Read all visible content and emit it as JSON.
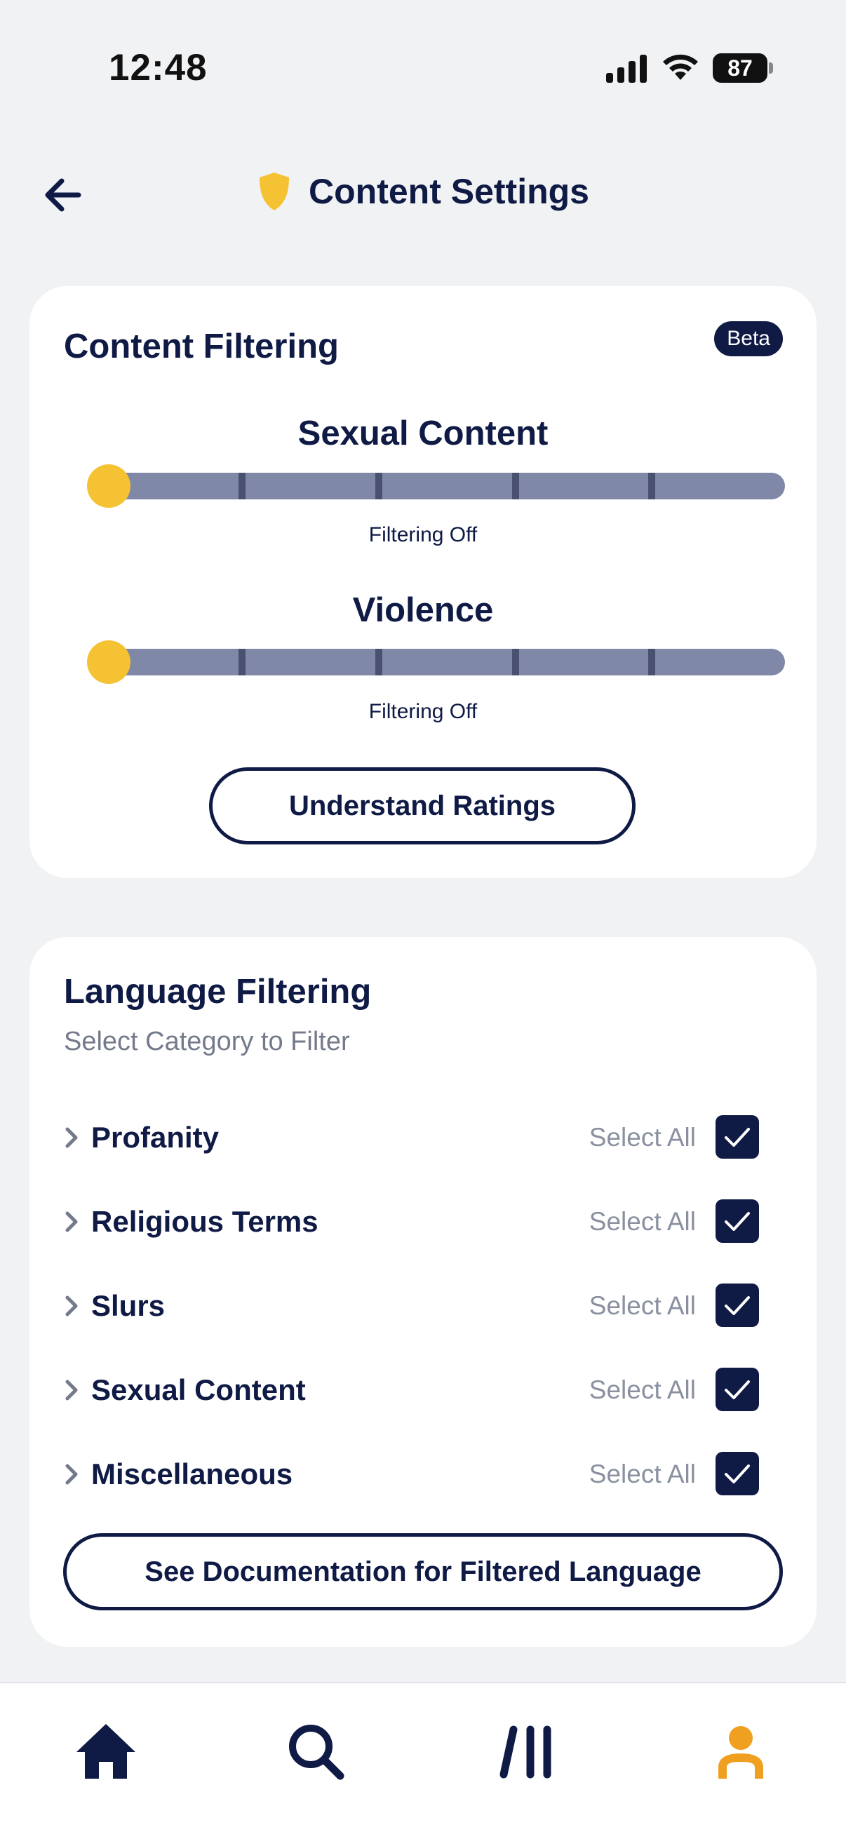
{
  "status_bar": {
    "time": "12:48",
    "battery": "87"
  },
  "header": {
    "title": "Content Settings",
    "back_icon": "arrow-left-icon",
    "title_icon": "shield-icon"
  },
  "content_filtering": {
    "heading": "Content Filtering",
    "badge": "Beta",
    "sliders": [
      {
        "label": "Sexual Content",
        "caption": "Filtering Off",
        "level": 0,
        "steps": 5
      },
      {
        "label": "Violence",
        "caption": "Filtering Off",
        "level": 0,
        "steps": 5
      }
    ],
    "understand_button": "Understand Ratings"
  },
  "language_filtering": {
    "heading": "Language Filtering",
    "subheading": "Select Category to Filter",
    "select_all_label": "Select All",
    "categories": [
      {
        "label": "Profanity",
        "checked": true
      },
      {
        "label": "Religious Terms",
        "checked": true
      },
      {
        "label": "Slurs",
        "checked": true
      },
      {
        "label": "Sexual Content",
        "checked": true
      },
      {
        "label": "Miscellaneous",
        "checked": true
      }
    ],
    "docs_button": "See Documentation for Filtered Language"
  },
  "bottom_nav": {
    "items": [
      "home-icon",
      "search-icon",
      "library-icon",
      "profile-icon"
    ],
    "active_color": "#f0a020",
    "inactive_color": "#0f1a45"
  },
  "colors": {
    "primary": "#0f1a45",
    "accent": "#f4c232",
    "track": "#7f88a6",
    "background": "#f1f2f4"
  }
}
